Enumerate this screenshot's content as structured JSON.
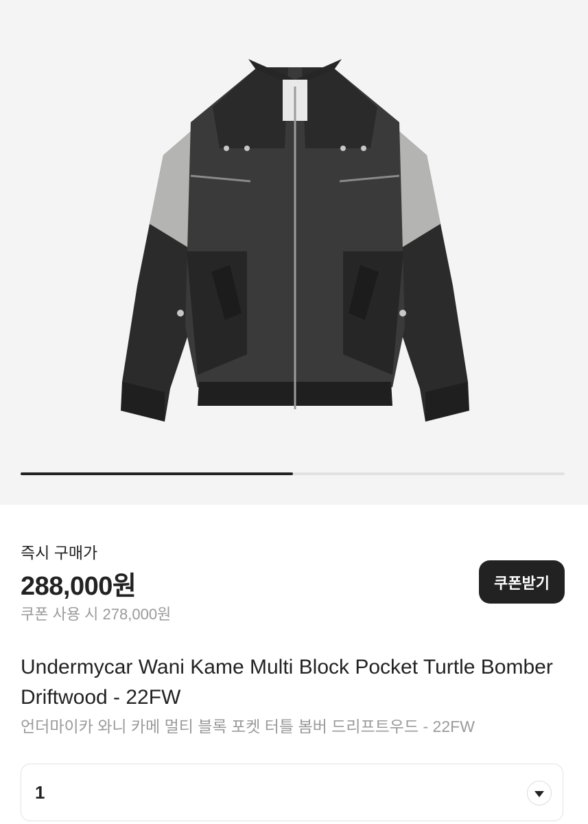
{
  "gallery": {
    "image_alt": "Undermycar Wani Kame Multi Block Pocket Turtle Bomber Driftwood",
    "progress": 0.5
  },
  "pricing": {
    "label": "즉시 구매가",
    "price": "288,000원",
    "coupon_price": "쿠폰 사용 시 278,000원",
    "coupon_button": "쿠폰받기"
  },
  "product": {
    "title_en": "Undermycar Wani Kame Multi Block Pocket Turtle Bomber Driftwood - 22FW",
    "title_ko": "언더마이카 와니 카메 멀티 블록 포켓 터틀 봄버 드리프트우드 - 22FW"
  },
  "quantity": {
    "value": "1",
    "icon": "chevron-down-icon"
  },
  "colors": {
    "gallery_bg": "#f4f4f4",
    "button_bg": "#222222",
    "muted_text": "#9a9a9a"
  }
}
